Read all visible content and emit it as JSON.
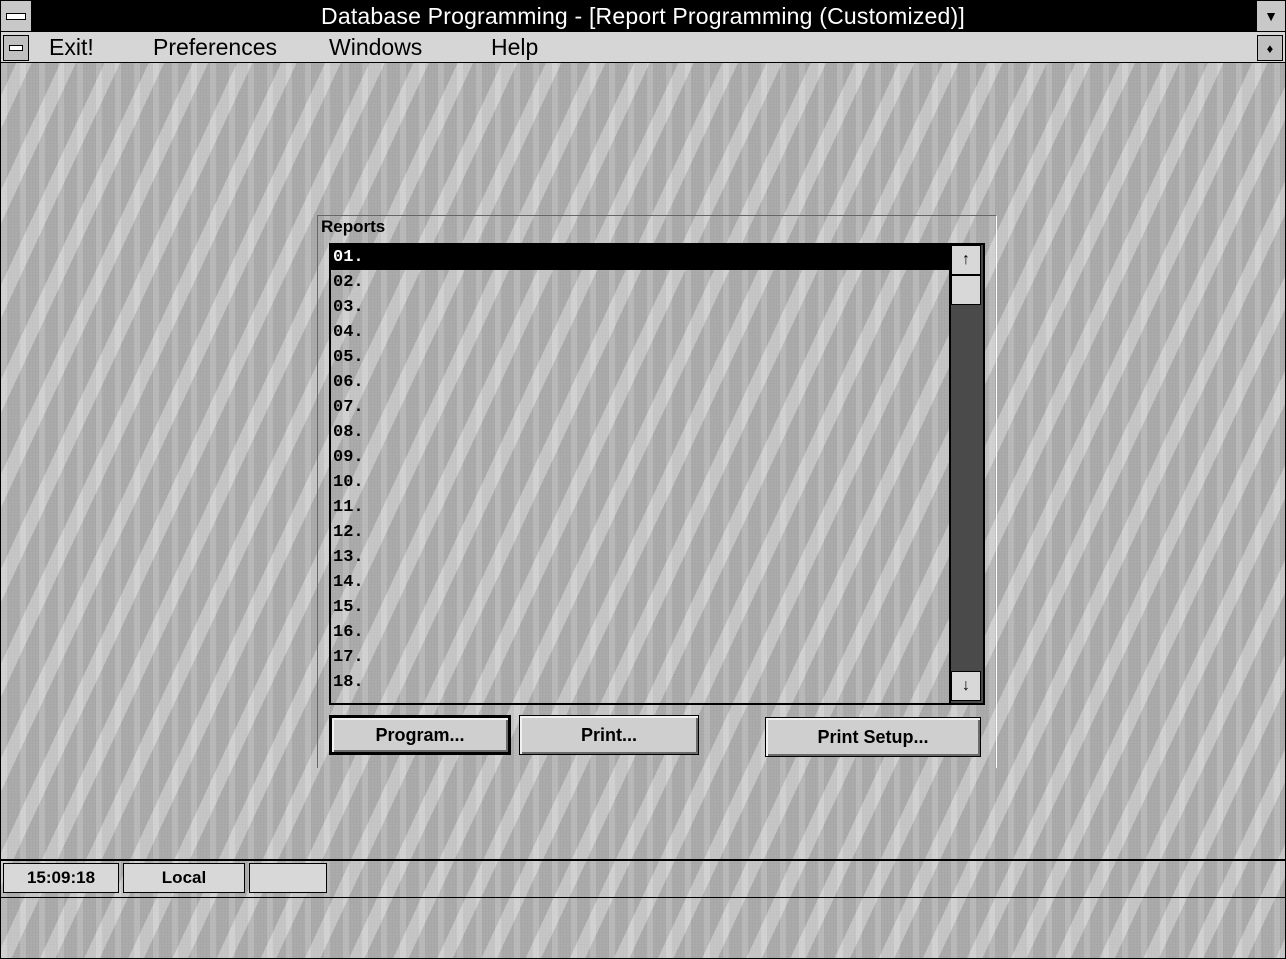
{
  "window": {
    "title": "Database Programming - [Report Programming (Customized)]",
    "maximize_icon": "chevron-down-icon"
  },
  "menu": {
    "exit": "Exit!",
    "preferences": "Preferences",
    "windows": "Windows",
    "help": "Help"
  },
  "reports": {
    "label": "Reports",
    "selected_index": 0,
    "items": [
      "01.",
      "02.",
      "03.",
      "04.",
      "05.",
      "06.",
      "07.",
      "08.",
      "09.",
      "10.",
      "11.",
      "12.",
      "13.",
      "14.",
      "15.",
      "16.",
      "17.",
      "18."
    ],
    "scroll_up_icon": "arrow-up-icon",
    "scroll_down_icon": "arrow-down-icon"
  },
  "buttons": {
    "program": "Program...",
    "print": "Print...",
    "print_setup": "Print Setup..."
  },
  "status": {
    "time": "15:09:18",
    "mode": "Local"
  }
}
